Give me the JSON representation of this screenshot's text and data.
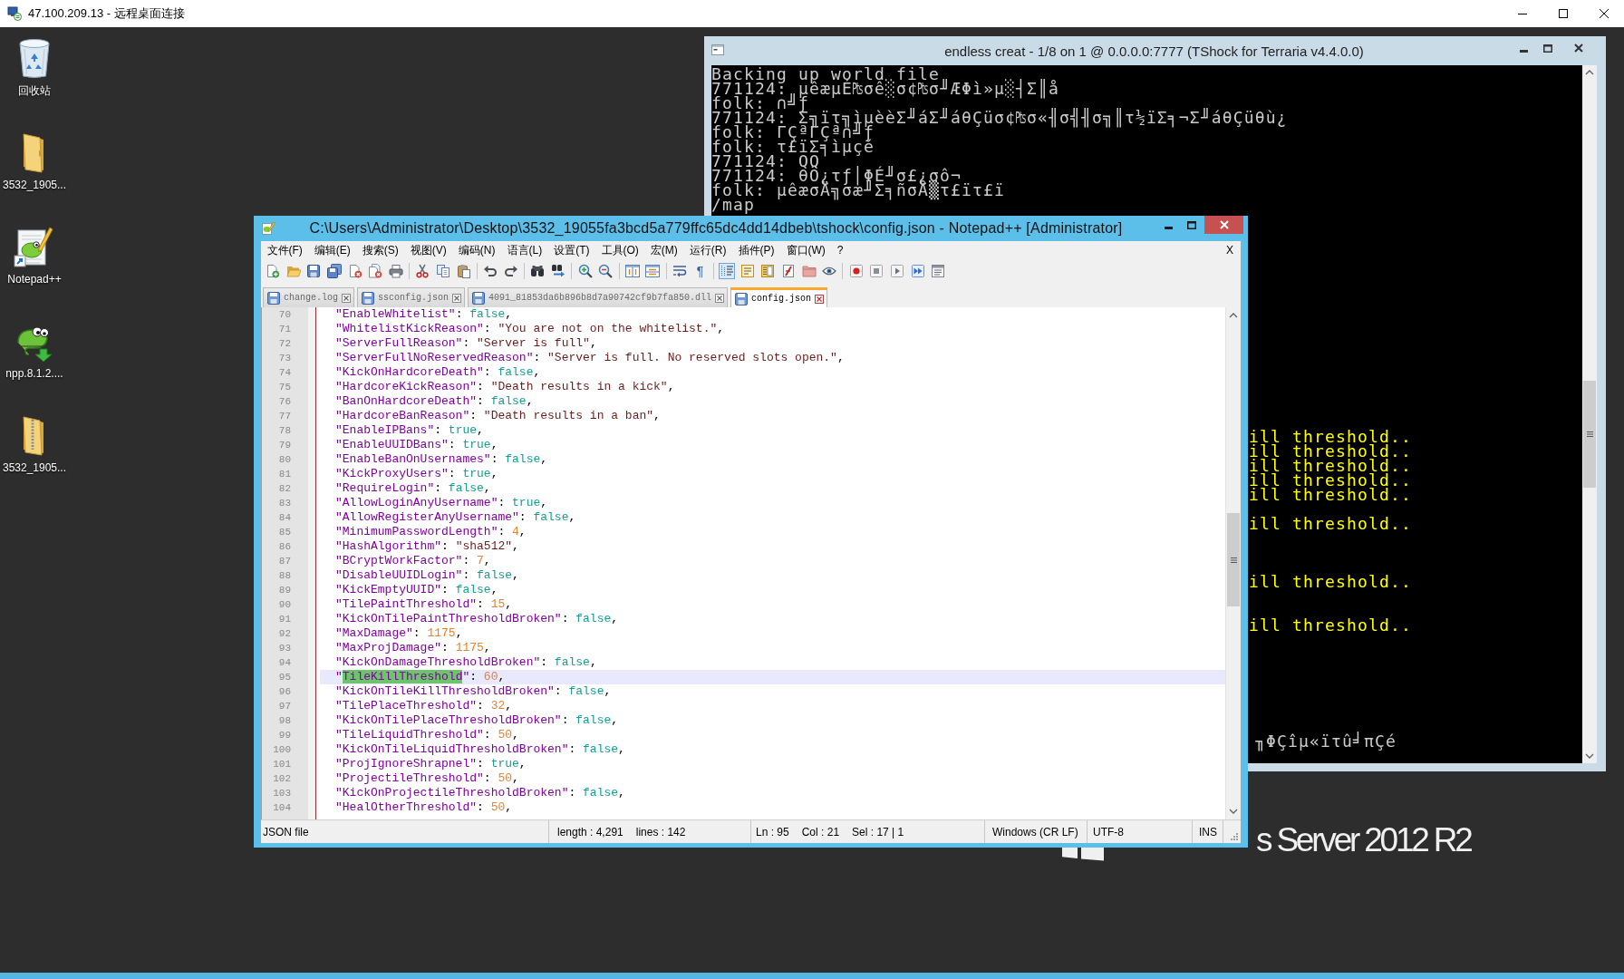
{
  "remote_desktop_window": {
    "title": "47.100.209.13 - 远程桌面连接"
  },
  "desktop_icons": [
    {
      "label": "回收站",
      "kind": "recycle-bin"
    },
    {
      "label": "3532_1905...",
      "kind": "folder"
    },
    {
      "label": "Notepad++",
      "kind": "shortcut"
    },
    {
      "label": "npp.8.1.2....",
      "kind": "installer"
    },
    {
      "label": "3532_1905...",
      "kind": "zip"
    }
  ],
  "console_window": {
    "title": "endless creat - 1/8 on 1 @ 0.0.0.0:7777 (TShock for Terraria v4.4.0.0)",
    "lines": [
      {
        "text": "Backing up world file",
        "color": "#cccccc"
      },
      {
        "text": "771124: µêæµÉ₧σê░σ¢₧σ╜ÆΦì»µ░┤Σ║å",
        "color": "#cccccc"
      },
      {
        "text": "folk: ∩╝ƒ",
        "color": "#cccccc"
      },
      {
        "text": "771124: Σ╗ïτ╗ìµèèΣ╜áΣ╜áθÇüσ¢₧σ«╢σ╣╢σ╗║τ½ïΣ╕¬Σ╜áθÇüθù¿",
        "color": "#cccccc"
      },
      {
        "text": "folk: ΓÇªΓÇª∩╝ƒ",
        "color": "#cccccc"
      },
      {
        "text": "folk: τ£ïΣ╕ìµçé",
        "color": "#cccccc"
      },
      {
        "text": "771124: QQ",
        "color": "#cccccc"
      },
      {
        "text": "771124: θÖ¿τƒ│ΦÉ╜σ£¿σô¬",
        "color": "#cccccc"
      },
      {
        "text": "folk: µêæσÄ╗σæ╜Σ╕ñσÅ▒τ£ïτ£ï",
        "color": "#cccccc"
      },
      {
        "text": "/map",
        "color": "#cccccc"
      }
    ],
    "tail_lines": [
      {
        "text": "ill threshold..",
        "color": "#ffff00"
      },
      {
        "text": "ill threshold..",
        "color": "#ffff00"
      },
      {
        "text": "ill threshold..",
        "color": "#ffff00"
      },
      {
        "text": "ill threshold..",
        "color": "#ffff00"
      },
      {
        "text": "ill threshold..",
        "color": "#ffff00"
      },
      {
        "text": "ill threshold..",
        "color": "#ffff00"
      },
      {
        "text": "ill threshold..",
        "color": "#ffff00"
      },
      {
        "text": "ill threshold..",
        "color": "#ffff00"
      },
      {
        "text": "╖ΦÇîµ«ïτû╛πÇé",
        "color": "#cccccc"
      }
    ]
  },
  "notepad_window": {
    "title": "C:\\Users\\Administrator\\Desktop\\3532_19055fa3bcd5a779ffc65dc4dd14dbeb\\tshock\\config.json - Notepad++ [Administrator]",
    "menu": [
      "文件(F)",
      "编辑(E)",
      "搜索(S)",
      "视图(V)",
      "编码(N)",
      "语言(L)",
      "设置(T)",
      "工具(O)",
      "宏(M)",
      "运行(R)",
      "插件(P)",
      "窗口(W)",
      "?"
    ],
    "menu_close": "X",
    "toolbar": [
      [
        {
          "kind": "new",
          "pressed": false
        },
        {
          "kind": "open",
          "pressed": false
        },
        {
          "kind": "save",
          "pressed": false
        },
        {
          "kind": "save-all",
          "pressed": false
        },
        {
          "kind": "close",
          "pressed": false
        },
        {
          "kind": "close-all",
          "pressed": false
        },
        {
          "kind": "print",
          "pressed": false
        }
      ],
      [
        {
          "kind": "cut",
          "pressed": false
        },
        {
          "kind": "copy",
          "pressed": false
        },
        {
          "kind": "paste",
          "pressed": false
        }
      ],
      [
        {
          "kind": "undo",
          "pressed": false
        },
        {
          "kind": "redo",
          "pressed": false
        }
      ],
      [
        {
          "kind": "find",
          "pressed": false
        },
        {
          "kind": "replace",
          "pressed": false
        }
      ],
      [
        {
          "kind": "zoom-in",
          "pressed": false
        },
        {
          "kind": "zoom-out",
          "pressed": false
        }
      ],
      [
        {
          "kind": "sync-vertical",
          "pressed": false
        },
        {
          "kind": "sync-horizontal",
          "pressed": false
        }
      ],
      [
        {
          "kind": "word-wrap",
          "pressed": false
        },
        {
          "kind": "all-chars",
          "glyph": "¶",
          "pressed": false
        }
      ],
      [
        {
          "kind": "indent-guide",
          "pressed": true
        },
        {
          "kind": "user-language",
          "pressed": false
        },
        {
          "kind": "document-map",
          "pressed": false
        },
        {
          "kind": "function-list",
          "pressed": false
        },
        {
          "kind": "folder-workspace",
          "pressed": false
        },
        {
          "kind": "monitoring",
          "pressed": false
        }
      ],
      [
        {
          "kind": "record",
          "pressed": false
        },
        {
          "kind": "stop",
          "pressed": false
        },
        {
          "kind": "play",
          "pressed": false
        },
        {
          "kind": "play-multiple",
          "pressed": false
        },
        {
          "kind": "save-macro",
          "pressed": false
        }
      ]
    ],
    "tabs": [
      {
        "label": "change.log",
        "selected": false
      },
      {
        "label": "ssconfig.json",
        "selected": false
      },
      {
        "label": "4091_81853da6b896b8d7a90742cf9b7fa850.dll",
        "selected": false
      },
      {
        "label": "config.json",
        "selected": true
      }
    ],
    "editor": {
      "lines": [
        {
          "number": "70",
          "current": false,
          "tokens": [
            {
              "kind": "key",
              "text": "\"EnableWhitelist\""
            },
            {
              "kind": "punct",
              "text": ": "
            },
            {
              "kind": "boolean",
              "text": "false"
            },
            {
              "kind": "punct",
              "text": ","
            }
          ]
        },
        {
          "number": "71",
          "current": false,
          "tokens": [
            {
              "kind": "key",
              "text": "\"WhitelistKickReason\""
            },
            {
              "kind": "punct",
              "text": ": "
            },
            {
              "kind": "string",
              "text": "\"You are not on the whitelist.\""
            },
            {
              "kind": "punct",
              "text": ","
            }
          ]
        },
        {
          "number": "72",
          "current": false,
          "tokens": [
            {
              "kind": "key",
              "text": "\"ServerFullReason\""
            },
            {
              "kind": "punct",
              "text": ": "
            },
            {
              "kind": "string",
              "text": "\"Server is full\""
            },
            {
              "kind": "punct",
              "text": ","
            }
          ]
        },
        {
          "number": "73",
          "current": false,
          "tokens": [
            {
              "kind": "key",
              "text": "\"ServerFullNoReservedReason\""
            },
            {
              "kind": "punct",
              "text": ": "
            },
            {
              "kind": "string",
              "text": "\"Server is full. No reserved slots open.\""
            },
            {
              "kind": "punct",
              "text": ","
            }
          ]
        },
        {
          "number": "74",
          "current": false,
          "tokens": [
            {
              "kind": "key",
              "text": "\"KickOnHardcoreDeath\""
            },
            {
              "kind": "punct",
              "text": ": "
            },
            {
              "kind": "boolean",
              "text": "false"
            },
            {
              "kind": "punct",
              "text": ","
            }
          ]
        },
        {
          "number": "75",
          "current": false,
          "tokens": [
            {
              "kind": "key",
              "text": "\"HardcoreKickReason\""
            },
            {
              "kind": "punct",
              "text": ": "
            },
            {
              "kind": "string",
              "text": "\"Death results in a kick\""
            },
            {
              "kind": "punct",
              "text": ","
            }
          ]
        },
        {
          "number": "76",
          "current": false,
          "tokens": [
            {
              "kind": "key",
              "text": "\"BanOnHardcoreDeath\""
            },
            {
              "kind": "punct",
              "text": ": "
            },
            {
              "kind": "boolean",
              "text": "false"
            },
            {
              "kind": "punct",
              "text": ","
            }
          ]
        },
        {
          "number": "77",
          "current": false,
          "tokens": [
            {
              "kind": "key",
              "text": "\"HardcoreBanReason\""
            },
            {
              "kind": "punct",
              "text": ": "
            },
            {
              "kind": "string",
              "text": "\"Death results in a ban\""
            },
            {
              "kind": "punct",
              "text": ","
            }
          ]
        },
        {
          "number": "78",
          "current": false,
          "tokens": [
            {
              "kind": "key",
              "text": "\"EnableIPBans\""
            },
            {
              "kind": "punct",
              "text": ": "
            },
            {
              "kind": "boolean",
              "text": "true"
            },
            {
              "kind": "punct",
              "text": ","
            }
          ]
        },
        {
          "number": "79",
          "current": false,
          "tokens": [
            {
              "kind": "key",
              "text": "\"EnableUUIDBans\""
            },
            {
              "kind": "punct",
              "text": ": "
            },
            {
              "kind": "boolean",
              "text": "true"
            },
            {
              "kind": "punct",
              "text": ","
            }
          ]
        },
        {
          "number": "80",
          "current": false,
          "tokens": [
            {
              "kind": "key",
              "text": "\"EnableBanOnUsernames\""
            },
            {
              "kind": "punct",
              "text": ": "
            },
            {
              "kind": "boolean",
              "text": "false"
            },
            {
              "kind": "punct",
              "text": ","
            }
          ]
        },
        {
          "number": "81",
          "current": false,
          "tokens": [
            {
              "kind": "key",
              "text": "\"KickProxyUsers\""
            },
            {
              "kind": "punct",
              "text": ": "
            },
            {
              "kind": "boolean",
              "text": "true"
            },
            {
              "kind": "punct",
              "text": ","
            }
          ]
        },
        {
          "number": "82",
          "current": false,
          "tokens": [
            {
              "kind": "key",
              "text": "\"RequireLogin\""
            },
            {
              "kind": "punct",
              "text": ": "
            },
            {
              "kind": "boolean",
              "text": "false"
            },
            {
              "kind": "punct",
              "text": ","
            }
          ]
        },
        {
          "number": "83",
          "current": false,
          "tokens": [
            {
              "kind": "key",
              "text": "\"AllowLoginAnyUsername\""
            },
            {
              "kind": "punct",
              "text": ": "
            },
            {
              "kind": "boolean",
              "text": "true"
            },
            {
              "kind": "punct",
              "text": ","
            }
          ]
        },
        {
          "number": "84",
          "current": false,
          "tokens": [
            {
              "kind": "key",
              "text": "\"AllowRegisterAnyUsername\""
            },
            {
              "kind": "punct",
              "text": ": "
            },
            {
              "kind": "boolean",
              "text": "false"
            },
            {
              "kind": "punct",
              "text": ","
            }
          ]
        },
        {
          "number": "85",
          "current": false,
          "tokens": [
            {
              "kind": "key",
              "text": "\"MinimumPasswordLength\""
            },
            {
              "kind": "punct",
              "text": ": "
            },
            {
              "kind": "number",
              "text": "4"
            },
            {
              "kind": "punct",
              "text": ","
            }
          ]
        },
        {
          "number": "86",
          "current": false,
          "tokens": [
            {
              "kind": "key",
              "text": "\"HashAlgorithm\""
            },
            {
              "kind": "punct",
              "text": ": "
            },
            {
              "kind": "string",
              "text": "\"sha512\""
            },
            {
              "kind": "punct",
              "text": ","
            }
          ]
        },
        {
          "number": "87",
          "current": false,
          "tokens": [
            {
              "kind": "key",
              "text": "\"BCryptWorkFactor\""
            },
            {
              "kind": "punct",
              "text": ": "
            },
            {
              "kind": "number",
              "text": "7"
            },
            {
              "kind": "punct",
              "text": ","
            }
          ]
        },
        {
          "number": "88",
          "current": false,
          "tokens": [
            {
              "kind": "key",
              "text": "\"DisableUUIDLogin\""
            },
            {
              "kind": "punct",
              "text": ": "
            },
            {
              "kind": "boolean",
              "text": "false"
            },
            {
              "kind": "punct",
              "text": ","
            }
          ]
        },
        {
          "number": "89",
          "current": false,
          "tokens": [
            {
              "kind": "key",
              "text": "\"KickEmptyUUID\""
            },
            {
              "kind": "punct",
              "text": ": "
            },
            {
              "kind": "boolean",
              "text": "false"
            },
            {
              "kind": "punct",
              "text": ","
            }
          ]
        },
        {
          "number": "90",
          "current": false,
          "tokens": [
            {
              "kind": "key",
              "text": "\"TilePaintThreshold\""
            },
            {
              "kind": "punct",
              "text": ": "
            },
            {
              "kind": "number",
              "text": "15"
            },
            {
              "kind": "punct",
              "text": ","
            }
          ]
        },
        {
          "number": "91",
          "current": false,
          "tokens": [
            {
              "kind": "key",
              "text": "\"KickOnTilePaintThresholdBroken\""
            },
            {
              "kind": "punct",
              "text": ": "
            },
            {
              "kind": "boolean",
              "text": "false"
            },
            {
              "kind": "punct",
              "text": ","
            }
          ]
        },
        {
          "number": "92",
          "current": false,
          "tokens": [
            {
              "kind": "key",
              "text": "\"MaxDamage\""
            },
            {
              "kind": "punct",
              "text": ": "
            },
            {
              "kind": "number",
              "text": "1175"
            },
            {
              "kind": "punct",
              "text": ","
            }
          ]
        },
        {
          "number": "93",
          "current": false,
          "tokens": [
            {
              "kind": "key",
              "text": "\"MaxProjDamage\""
            },
            {
              "kind": "punct",
              "text": ": "
            },
            {
              "kind": "number",
              "text": "1175"
            },
            {
              "kind": "punct",
              "text": ","
            }
          ]
        },
        {
          "number": "94",
          "current": false,
          "tokens": [
            {
              "kind": "key",
              "text": "\"KickOnDamageThresholdBroken\""
            },
            {
              "kind": "punct",
              "text": ": "
            },
            {
              "kind": "boolean",
              "text": "false"
            },
            {
              "kind": "punct",
              "text": ","
            }
          ]
        },
        {
          "number": "95",
          "current": true,
          "tokens": [
            {
              "kind": "key",
              "text": "\""
            },
            {
              "kind": "selection",
              "text": "TileKillThreshold"
            },
            {
              "kind": "key",
              "text": "\""
            },
            {
              "kind": "punct",
              "text": ": "
            },
            {
              "kind": "number",
              "text": "60"
            },
            {
              "kind": "punct",
              "text": ","
            }
          ]
        },
        {
          "number": "96",
          "current": false,
          "tokens": [
            {
              "kind": "key",
              "text": "\"KickOnTileKillThresholdBroken\""
            },
            {
              "kind": "punct",
              "text": ": "
            },
            {
              "kind": "boolean",
              "text": "false"
            },
            {
              "kind": "punct",
              "text": ","
            }
          ]
        },
        {
          "number": "97",
          "current": false,
          "tokens": [
            {
              "kind": "key",
              "text": "\"TilePlaceThreshold\""
            },
            {
              "kind": "punct",
              "text": ": "
            },
            {
              "kind": "number",
              "text": "32"
            },
            {
              "kind": "punct",
              "text": ","
            }
          ]
        },
        {
          "number": "98",
          "current": false,
          "tokens": [
            {
              "kind": "key",
              "text": "\"KickOnTilePlaceThresholdBroken\""
            },
            {
              "kind": "punct",
              "text": ": "
            },
            {
              "kind": "boolean",
              "text": "false"
            },
            {
              "kind": "punct",
              "text": ","
            }
          ]
        },
        {
          "number": "99",
          "current": false,
          "tokens": [
            {
              "kind": "key",
              "text": "\"TileLiquidThreshold\""
            },
            {
              "kind": "punct",
              "text": ": "
            },
            {
              "kind": "number",
              "text": "50"
            },
            {
              "kind": "punct",
              "text": ","
            }
          ]
        },
        {
          "number": "100",
          "current": false,
          "tokens": [
            {
              "kind": "key",
              "text": "\"KickOnTileLiquidThresholdBroken\""
            },
            {
              "kind": "punct",
              "text": ": "
            },
            {
              "kind": "boolean",
              "text": "false"
            },
            {
              "kind": "punct",
              "text": ","
            }
          ]
        },
        {
          "number": "101",
          "current": false,
          "tokens": [
            {
              "kind": "key",
              "text": "\"ProjIgnoreShrapnel\""
            },
            {
              "kind": "punct",
              "text": ": "
            },
            {
              "kind": "boolean",
              "text": "true"
            },
            {
              "kind": "punct",
              "text": ","
            }
          ]
        },
        {
          "number": "102",
          "current": false,
          "tokens": [
            {
              "kind": "key",
              "text": "\"ProjectileThreshold\""
            },
            {
              "kind": "punct",
              "text": ": "
            },
            {
              "kind": "number",
              "text": "50"
            },
            {
              "kind": "punct",
              "text": ","
            }
          ]
        },
        {
          "number": "103",
          "current": false,
          "tokens": [
            {
              "kind": "key",
              "text": "\"KickOnProjectileThresholdBroken\""
            },
            {
              "kind": "punct",
              "text": ": "
            },
            {
              "kind": "boolean",
              "text": "false"
            },
            {
              "kind": "punct",
              "text": ","
            }
          ]
        },
        {
          "number": "104",
          "current": false,
          "tokens": [
            {
              "kind": "key",
              "text": "\"HealOtherThreshold\""
            },
            {
              "kind": "punct",
              "text": ": "
            },
            {
              "kind": "number",
              "text": "50"
            },
            {
              "kind": "punct",
              "text": ","
            }
          ]
        }
      ]
    },
    "status_bar": {
      "file_type": "JSON file",
      "length": "length : 4,291",
      "lines": "lines : 142",
      "line": "Ln : 95",
      "column": "Col : 21",
      "selection": "Sel : 17 | 1",
      "eol": "Windows (CR LF)",
      "encoding": "UTF-8",
      "mode": "INS"
    }
  },
  "desktop_branding": {
    "text": "s Server 2012 R2"
  }
}
